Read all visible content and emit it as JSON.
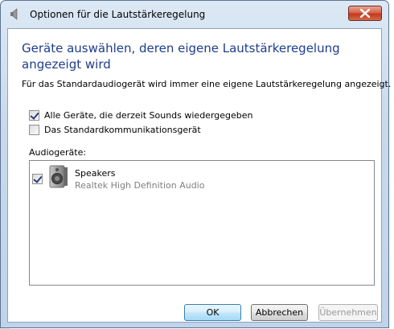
{
  "window": {
    "title": "Optionen für die Lautstärkeregelung",
    "close_icon": "close-icon"
  },
  "heading": "Geräte auswählen, deren eigene Lautstärkeregelung angezeigt wird",
  "description": "Für das Standardaudiogerät wird immer eine eigene Lautstärkeregelung angezeigt.",
  "options": [
    {
      "label": "Alle Geräte, die derzeit Sounds wiedergegeben",
      "checked": true
    },
    {
      "label": "Das Standardkommunikationsgerät",
      "checked": false
    }
  ],
  "audio_devices_label": "Audiogeräte:",
  "devices": [
    {
      "name": "Speakers",
      "description": "Realtek High Definition Audio",
      "checked": true,
      "icon": "speaker-icon"
    }
  ],
  "buttons": {
    "ok": "OK",
    "cancel": "Abbrechen",
    "apply": "Übernehmen"
  },
  "colors": {
    "heading": "#1e3d8c",
    "close_button": "#c4381a"
  }
}
